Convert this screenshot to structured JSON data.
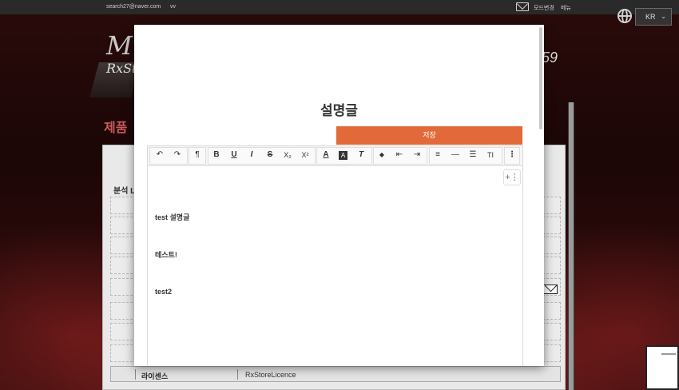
{
  "topbar": {
    "email": "search27@naver.com",
    "user": "vv",
    "mode_switch": "모드변경",
    "menu": "메뉴",
    "language": "KR"
  },
  "background": {
    "logo_fragment": "M",
    "logo_fragment2": "RxSto",
    "number_fragment": "59",
    "product_fragment": "제품",
    "analysis_fragment": "분석 L",
    "license_label": "라이센스",
    "license_value": "RxStoreLicence"
  },
  "modal": {
    "title": "설명글",
    "save_label": "저장"
  },
  "toolbar": {
    "undo_icon": "↶",
    "redo_icon": "↷",
    "paragraph_icon": "¶",
    "bold_icon": "B",
    "underline_icon": "U",
    "italic_icon": "I",
    "strike_icon": "S",
    "subscript_icon": "X₂",
    "superscript_icon": "X²",
    "font_color_icon": "A",
    "bg_color_icon": "A",
    "clear_format_icon": "T",
    "eraser_icon": "◆",
    "outdent_icon": "⇤",
    "indent_icon": "⇥",
    "align_icon": "≡",
    "hr_icon": "—",
    "list_icon": "☰",
    "line_height_icon": "TI",
    "more_icon": "⋮"
  },
  "editor": {
    "paragraphs": [
      "test 설명글",
      "테스트!",
      "test2"
    ],
    "plus_label": "+⋮"
  },
  "colors": {
    "accent": "#e2693a",
    "modal_bg": "#ffffff",
    "topbar_bg": "#2a2a2a"
  }
}
